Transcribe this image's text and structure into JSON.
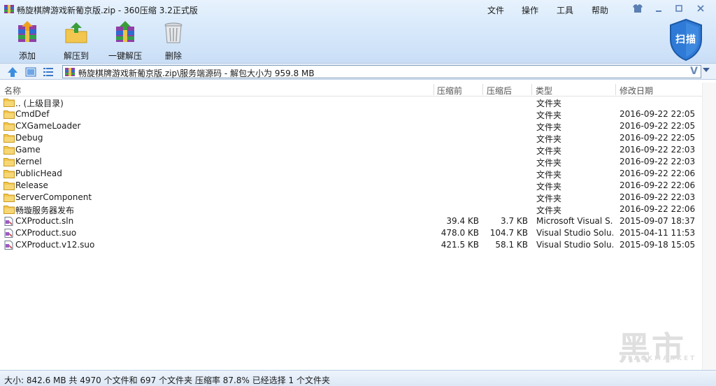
{
  "window": {
    "title": "畅旋棋牌游戏新葡京版.zip - 360压缩 3.2正式版",
    "menu": [
      "文件",
      "操作",
      "工具",
      "帮助"
    ]
  },
  "toolbar": {
    "add": "添加",
    "extract_to": "解压到",
    "one_click_extract": "一键解压",
    "delete": "删除",
    "scan": "扫描"
  },
  "address": {
    "path": "畅旋棋牌游戏新葡京版.zip\\服务端源码 - 解包大小为 959.8 MB"
  },
  "columns": {
    "name": "名称",
    "packed": "压缩前",
    "unpacked": "压缩后",
    "type": "类型",
    "modified": "修改日期"
  },
  "files": [
    {
      "name": ".. (上级目录)",
      "packed": "",
      "unpacked": "",
      "type": "文件夹",
      "modified": "",
      "icon": "folder-icon"
    },
    {
      "name": "CmdDef",
      "packed": "",
      "unpacked": "",
      "type": "文件夹",
      "modified": "2016-09-22 22:05",
      "icon": "folder-icon"
    },
    {
      "name": "CXGameLoader",
      "packed": "",
      "unpacked": "",
      "type": "文件夹",
      "modified": "2016-09-22 22:05",
      "icon": "folder-icon"
    },
    {
      "name": "Debug",
      "packed": "",
      "unpacked": "",
      "type": "文件夹",
      "modified": "2016-09-22 22:05",
      "icon": "folder-icon"
    },
    {
      "name": "Game",
      "packed": "",
      "unpacked": "",
      "type": "文件夹",
      "modified": "2016-09-22 22:03",
      "icon": "folder-icon"
    },
    {
      "name": "Kernel",
      "packed": "",
      "unpacked": "",
      "type": "文件夹",
      "modified": "2016-09-22 22:03",
      "icon": "folder-icon"
    },
    {
      "name": "PublicHead",
      "packed": "",
      "unpacked": "",
      "type": "文件夹",
      "modified": "2016-09-22 22:06",
      "icon": "folder-icon"
    },
    {
      "name": "Release",
      "packed": "",
      "unpacked": "",
      "type": "文件夹",
      "modified": "2016-09-22 22:06",
      "icon": "folder-icon"
    },
    {
      "name": "ServerComponent",
      "packed": "",
      "unpacked": "",
      "type": "文件夹",
      "modified": "2016-09-22 22:03",
      "icon": "folder-icon"
    },
    {
      "name": "畅璇服务器发布",
      "packed": "",
      "unpacked": "",
      "type": "文件夹",
      "modified": "2016-09-22 22:06",
      "icon": "folder-icon"
    },
    {
      "name": "CXProduct.sln",
      "packed": "39.4 KB",
      "unpacked": "3.7 KB",
      "type": "Microsoft Visual S...",
      "modified": "2015-09-07 18:37",
      "icon": "file-icon"
    },
    {
      "name": "CXProduct.suo",
      "packed": "478.0 KB",
      "unpacked": "104.7 KB",
      "type": "Visual Studio Solu...",
      "modified": "2015-04-11 11:53",
      "icon": "file-icon"
    },
    {
      "name": "CXProduct.v12.suo",
      "packed": "421.5 KB",
      "unpacked": "58.1 KB",
      "type": "Visual Studio Solu...",
      "modified": "2015-09-18 15:05",
      "icon": "file-icon"
    }
  ],
  "status": {
    "text": "大小: 842.6 MB 共 4970 个文件和 697 个文件夹 压缩率 87.8% 已经选择 1 个文件夹"
  },
  "watermark": {
    "logo": "黑市",
    "sub": "BLACKMARKET"
  },
  "colors": {
    "accent": "#2a6fc9",
    "folder": "#f2c64f",
    "toolbar_bg": "#d8e9fb"
  }
}
